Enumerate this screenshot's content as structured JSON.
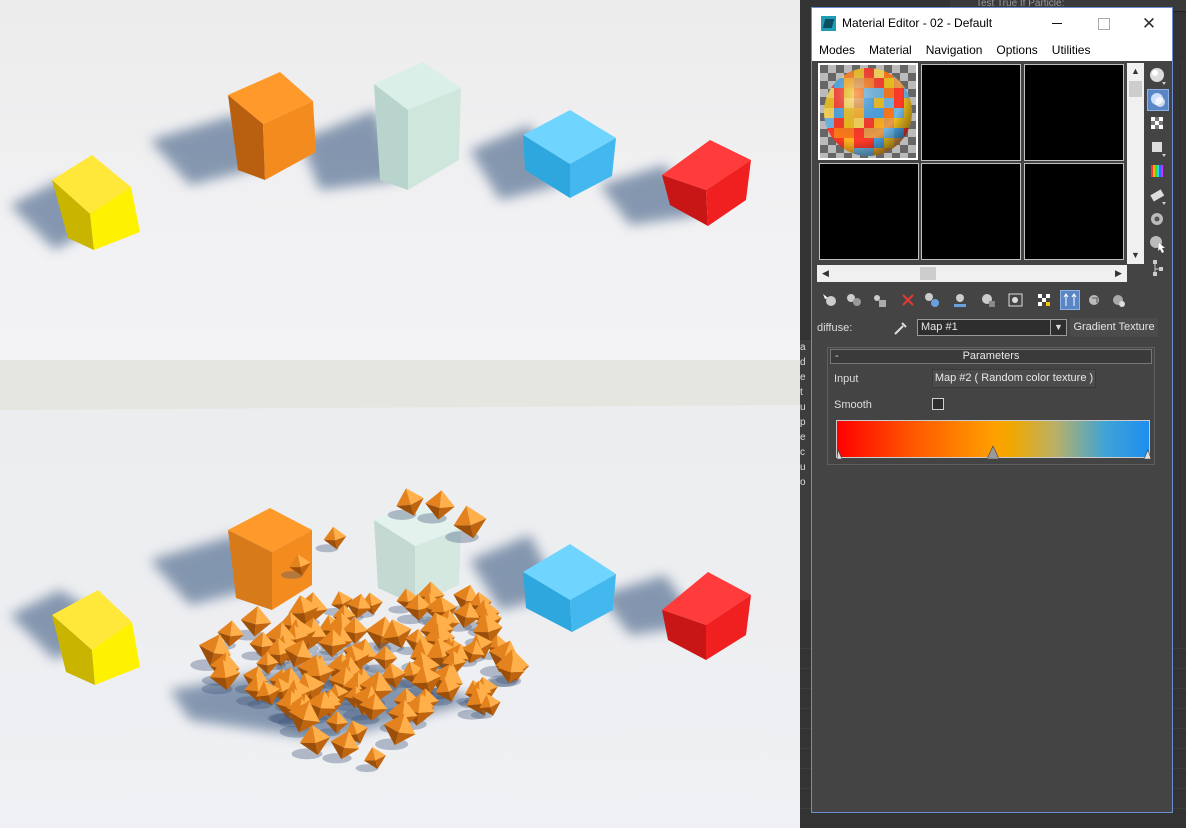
{
  "background": {
    "top_strip_text": "Test True If Particle:",
    "side_text_fragments": [
      "a",
      "d",
      "e",
      "t",
      "u",
      "p",
      "e",
      "c",
      "u",
      "o"
    ]
  },
  "material_editor": {
    "window_title": "Material Editor - 02 - Default",
    "window_controls": {
      "minimize": "",
      "maximize": "",
      "close": "✕"
    },
    "menu": [
      "Modes",
      "Material",
      "Navigation",
      "Options",
      "Utilities"
    ],
    "scroll_arrows": {
      "up": "▲",
      "down": "▼",
      "left": "◀",
      "right": "▶"
    },
    "map_row": {
      "label": "diffuse:",
      "map_name": "Map #1",
      "caret": "▼",
      "map_type": "Gradient Texture"
    },
    "parameters": {
      "title": "Parameters",
      "collapse": "-",
      "input_label": "Input",
      "input_value": "Map #2  ( Random color texture )",
      "smooth_label": "Smooth",
      "smooth_checked": false,
      "gradient_stops": [
        "#ff0000",
        "#ff9f00",
        "#1e8eef"
      ],
      "marker_positions": [
        0.0,
        0.5,
        1.0
      ]
    }
  },
  "colors": {
    "accent": "#5b86c6",
    "window_border": "#6a8ecf",
    "panel_bg": "#444444"
  }
}
